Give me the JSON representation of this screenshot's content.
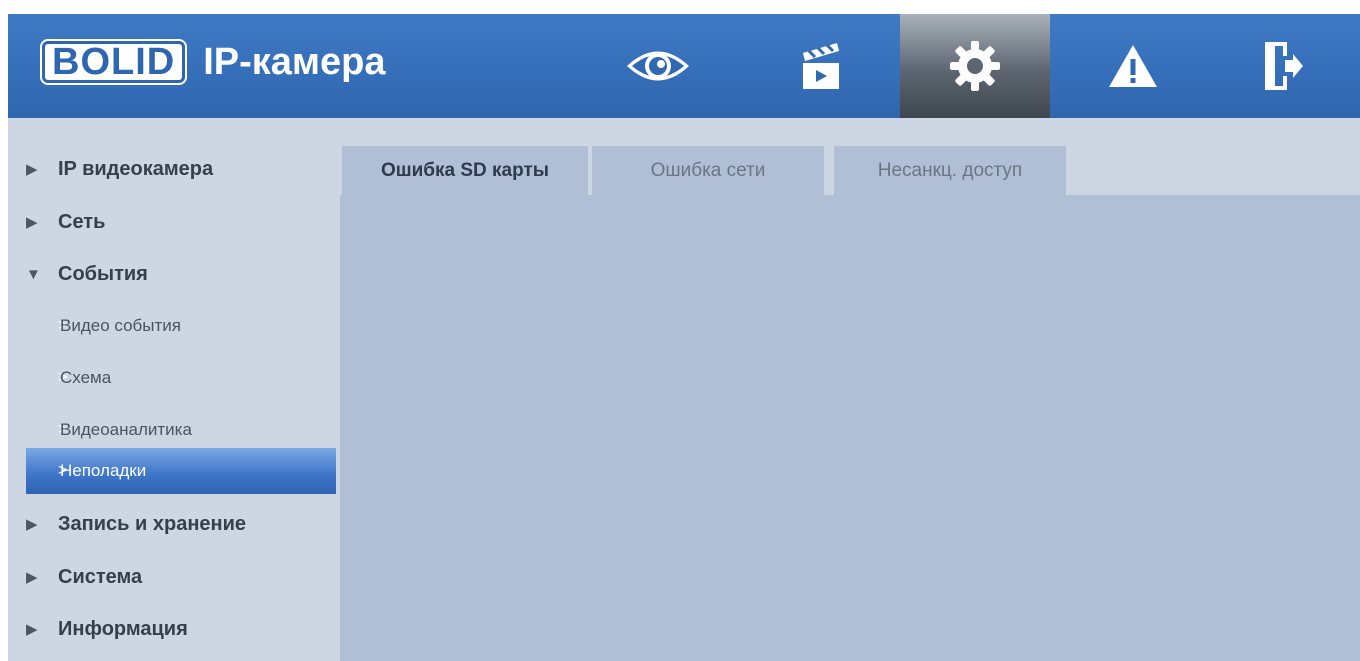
{
  "header": {
    "logo_brand": "BOLID",
    "logo_text": "IP-камера",
    "nav_icons": [
      "eye-icon",
      "clapperboard-icon",
      "gear-icon",
      "warning-icon",
      "exit-icon"
    ],
    "active_icon": "gear-icon",
    "color": "#3068b2"
  },
  "sidebar": {
    "items": [
      {
        "label": "IP видеокамера",
        "expanded": false
      },
      {
        "label": "Сеть",
        "expanded": false
      },
      {
        "label": "События",
        "expanded": true,
        "children": [
          {
            "label": "Видео события"
          },
          {
            "label": "Схема"
          },
          {
            "label": "Видеоаналитика"
          },
          {
            "label": "Неполадки",
            "active": true
          }
        ]
      },
      {
        "label": "Запись и хранение",
        "expanded": false
      },
      {
        "label": "Система",
        "expanded": false
      },
      {
        "label": "Информация",
        "expanded": false
      }
    ]
  },
  "main": {
    "tabs": [
      {
        "label": "Ошибка SD карты",
        "active": true
      },
      {
        "label": "Ошибка сети",
        "active": false
      },
      {
        "label": "Несанкц. доступ",
        "active": false
      }
    ]
  }
}
